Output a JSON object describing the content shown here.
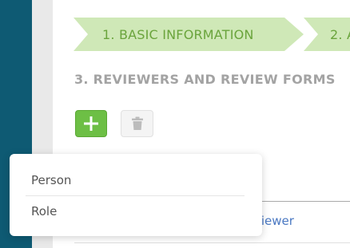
{
  "wizard": {
    "steps": [
      {
        "label": "1. BASIC INFORMATION"
      },
      {
        "label": "2. A"
      }
    ]
  },
  "section": {
    "title": "3. REVIEWERS AND REVIEW FORMS"
  },
  "toolbar": {
    "add_icon": "plus-icon",
    "delete_icon": "trash-icon"
  },
  "table": {
    "partial_link": "viewer"
  },
  "dropdown": {
    "items": [
      {
        "label": "Person"
      },
      {
        "label": "Role"
      }
    ]
  },
  "colors": {
    "rail": "#0e5a73",
    "step_bg": "#cfe8b7",
    "step_text": "#6aa43c",
    "add_button": "#6dbf45",
    "link": "#4a78c2"
  }
}
